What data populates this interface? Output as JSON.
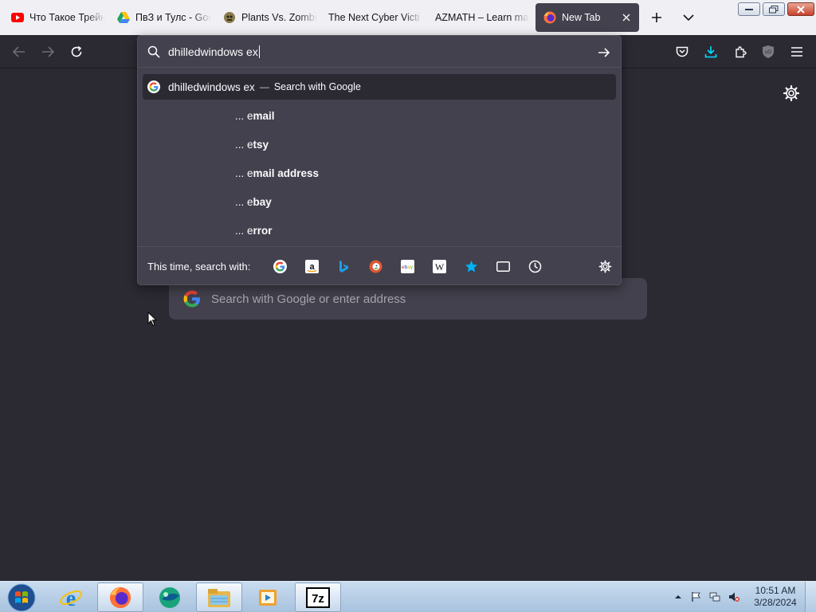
{
  "tabs": [
    {
      "title": "Что Такое Трейн",
      "favicon": "youtube-icon",
      "color": "#ff0000"
    },
    {
      "title": "ПвЗ и Тулс - Goo",
      "favicon": "google-drive-icon",
      "color": "#1fa463"
    },
    {
      "title": "Plants Vs. Zombi",
      "favicon": "zombie-icon",
      "color": "#7a6a3a"
    },
    {
      "title": "The Next Cyber Victi",
      "favicon": "",
      "color": ""
    },
    {
      "title": "AZMATH – Learn ma",
      "favicon": "",
      "color": ""
    },
    {
      "title": "New Tab",
      "favicon": "firefox-icon",
      "color": "#ff7139",
      "active": true
    }
  ],
  "urlbar": {
    "typed": "dhilledwindows ex",
    "top_result": {
      "text": "dhilledwindows ex",
      "separator": "—",
      "action": "Search with Google"
    },
    "suggestions": [
      {
        "prefix": "... e",
        "rest": "mail"
      },
      {
        "prefix": "... e",
        "rest": "tsy"
      },
      {
        "prefix": "... e",
        "rest": "mail address"
      },
      {
        "prefix": "... e",
        "rest": "bay"
      },
      {
        "prefix": "... e",
        "rest": "rror"
      }
    ],
    "oneoff_label": "This time, search with:",
    "engines": [
      "google-icon",
      "amazon-icon",
      "bing-icon",
      "duckduckgo-icon",
      "ebay-icon",
      "wikipedia-icon",
      "bookmarks-star-icon",
      "tabs-icon",
      "history-icon"
    ]
  },
  "newtab": {
    "search_placeholder": "Search with Google or enter address"
  },
  "taskbar": {
    "items": [
      "start-orb-icon",
      "internet-explorer-icon",
      "firefox-icon",
      "app-globe-icon",
      "file-explorer-icon",
      "media-player-icon",
      "7zip-icon"
    ],
    "clock_time": "10:51 AM",
    "clock_date": "3/28/2024"
  },
  "colors": {
    "accent_download": "#00ddff",
    "chrome_dark": "#2b2a33",
    "panel": "#42414d",
    "bookmark_star": "#00b3f4"
  }
}
